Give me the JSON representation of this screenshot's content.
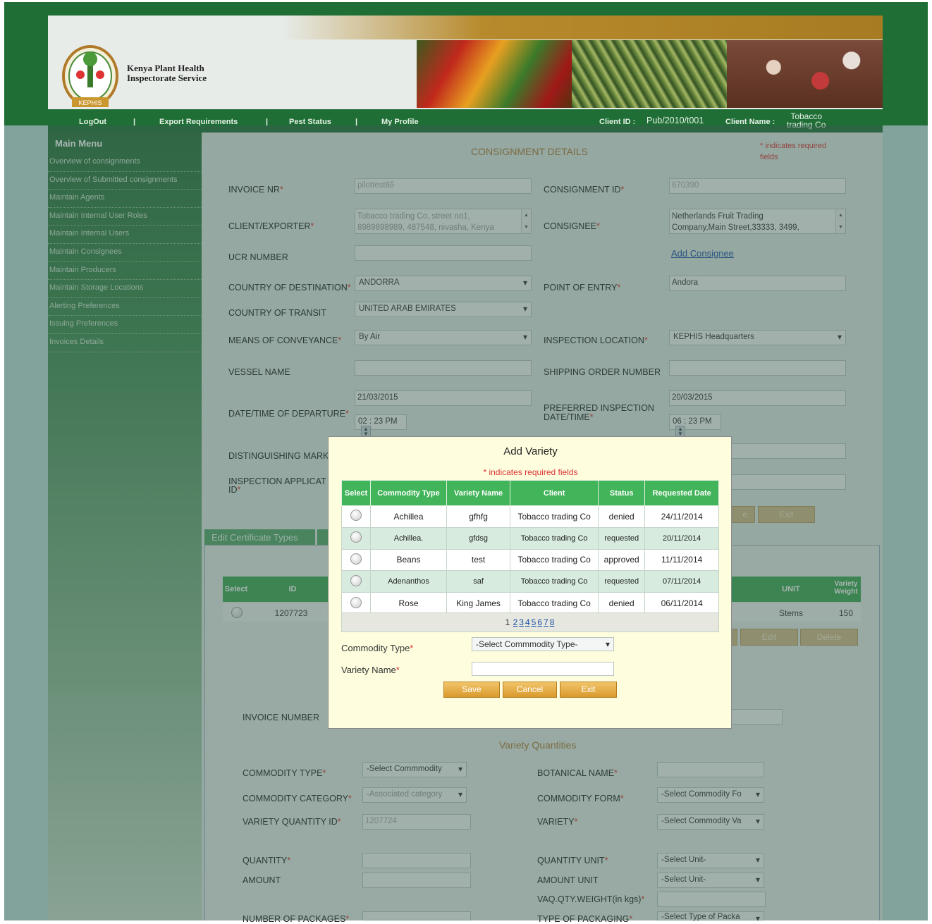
{
  "header": {
    "org_name_line1": "Kenya Plant Health",
    "org_name_line2": "Inspectorate Service",
    "logo_text": "KEPHIS"
  },
  "nav": {
    "logout": "LogOut",
    "sep": "|",
    "export_requirements": "Export Requirements",
    "pest_status": "Pest Status",
    "my_profile": "My Profile",
    "client_id_label": "Client ID  :",
    "client_id_value": "Pub/2010/t001",
    "client_name_label": "Client Name  :",
    "client_name_value_1": "Tobacco",
    "client_name_value_2": "trading Co"
  },
  "sidebar": {
    "title": "Main Menu",
    "items": [
      "Overview of consignments",
      "Overview of Submitted consignments",
      "Maintain Agents",
      "Maintain Internal User Roles",
      "Maintain Internal Users",
      "Maintain Consignees",
      "Maintain Producers",
      "Maintain Storage Locations",
      "Alerting Preferences",
      "Issuing Preferences",
      "Invoices Details"
    ]
  },
  "form": {
    "section_title": "CONSIGNMENT DETAILS",
    "required_note_1": "* indicates required",
    "required_note_2": "fields",
    "star": "*",
    "invoice_nr_label": "INVOICE NR",
    "invoice_nr_value": "pilottest65",
    "consignment_id_label": "CONSIGNMENT ID",
    "consignment_id_value": "670390",
    "client_exporter_label": "CLIENT/EXPORTER",
    "client_exporter_value_1": "Tobacco trading Co, street no1,",
    "client_exporter_value_2": "8989898989, 487548, nivasha, Kenya",
    "consignee_label": "CONSIGNEE",
    "consignee_value_1": "Netherlands Fruit Trading",
    "consignee_value_2": "Company,Main Street,33333, 3499,",
    "ucr_label": "UCR NUMBER",
    "add_consignee": "Add Consignee",
    "country_dest_label": "COUNTRY OF DESTINATION",
    "country_dest_value": "ANDORRA",
    "point_entry_label": "POINT OF ENTRY",
    "point_entry_value": "Andora",
    "country_transit_label": "COUNTRY OF TRANSIT",
    "country_transit_value": "UNITED ARAB EMIRATES",
    "conveyance_label": "MEANS OF CONVEYANCE",
    "conveyance_value": "By Air",
    "inspection_location_label": "INSPECTION LOCATION",
    "inspection_location_value": "KEPHIS Headquarters",
    "vessel_label": "VESSEL NAME",
    "shipping_order_label": "SHIPPING ORDER NUMBER",
    "departure_label": "DATE/TIME OF DEPARTURE",
    "departure_date": "21/03/2015",
    "departure_time": "02 : 23 PM",
    "pref_insp_label_1": "PREFERRED INSPECTION",
    "pref_insp_label_2": "DATE/TIME",
    "pref_insp_date": "20/03/2015",
    "pref_insp_time": "06 : 23 PM",
    "distinguishing_label": "DISTINGUISHING MARK",
    "insp_app_label_1": "INSPECTION APPLICAT",
    "insp_app_label_2": "ID",
    "exit_btn": "Exit",
    "save_btn_partial": "e"
  },
  "cert_section": {
    "tab_label": "Edit Certificate Types",
    "col_select": "Select",
    "col_id": "ID",
    "col_unit": "UNIT",
    "col_weight_1": "Variety",
    "col_weight_2": "Weight",
    "row_id": "1207723",
    "row_unit": "Stems",
    "row_weight": "150",
    "edit_btn": "Edit",
    "delete_btn": "Delete"
  },
  "invoice_section": {
    "invoice_number_label": "INVOICE NUMBER",
    "variety_quantities_title": "Variety Quantities",
    "commodity_type_label": "COMMODITY TYPE",
    "commodity_type_value": "-Select Commmodity",
    "botanical_label": "BOTANICAL NAME",
    "commodity_category_label": "COMMODITY CATEGORY",
    "commodity_category_value": "-Associated category",
    "commodity_form_label": "COMMODITY FORM",
    "commodity_form_value": "-Select Commodity Fo",
    "variety_qty_id_label": "VARIETY QUANTITY ID",
    "variety_qty_id_value": "1207724",
    "variety_label": "VARIETY",
    "variety_value": "-Select Commodity Va",
    "quantity_label": "QUANTITY",
    "quantity_unit_label": "QUANTITY UNIT",
    "quantity_unit_value": "-Select Unit-",
    "amount_label": "AMOUNT",
    "amount_unit_label": "AMOUNT UNIT",
    "amount_unit_value": "-Select Unit-",
    "vaq_label": "VAQ.QTY.WEIGHT(in kgs)",
    "packages_label": "NUMBER OF PACKAGES",
    "packaging_label": "TYPE OF PACKAGING",
    "packaging_value": "-Select Type of Packa"
  },
  "modal": {
    "title": "Add Variety",
    "required_note": "* indicates required fields",
    "columns": [
      "Select",
      "Commodity Type",
      "Variety Name",
      "Client",
      "Status",
      "Requested Date"
    ],
    "rows": [
      {
        "commodity": "Achillea",
        "variety": "gfhfg",
        "client": "Tobacco trading Co",
        "status": "denied",
        "date": "24/11/2014"
      },
      {
        "commodity": "Achillea.",
        "variety": "gfdsg",
        "client": "Tobacco trading Co",
        "status": "requested",
        "date": "20/11/2014"
      },
      {
        "commodity": "Beans",
        "variety": "test",
        "client": "Tobacco trading Co",
        "status": "approved",
        "date": "11/11/2014"
      },
      {
        "commodity": "Adenanthos",
        "variety": "saf",
        "client": "Tobacco trading Co",
        "status": "requested",
        "date": "07/11/2014"
      },
      {
        "commodity": "Rose",
        "variety": "King James",
        "client": "Tobacco trading Co",
        "status": "denied",
        "date": "06/11/2014"
      }
    ],
    "pages": [
      "1",
      "2",
      "3",
      "4",
      "5",
      "6",
      "7",
      "8"
    ],
    "commodity_type_label": "Commodity Type",
    "commodity_type_value": "-Select Commmodity Type-",
    "variety_name_label": "Variety Name",
    "save": "Save",
    "cancel": "Cancel",
    "exit": "Exit"
  }
}
